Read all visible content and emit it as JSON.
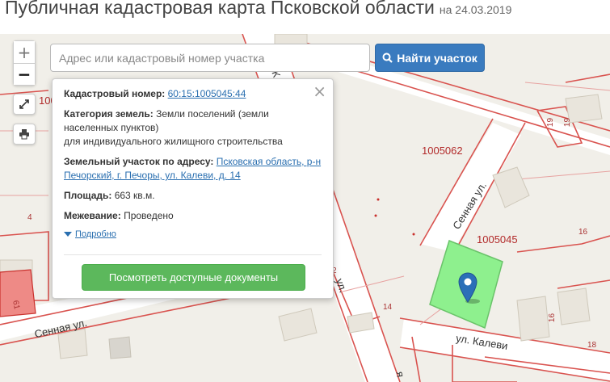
{
  "page": {
    "title": "Публичная кадастровая карта Псковской области",
    "date": "на 24.03.2019"
  },
  "search": {
    "placeholder": "Адрес или кадастровый номер участка",
    "value": "",
    "button_label": "Найти участок"
  },
  "zoom": {
    "plus": "+",
    "minus": "−"
  },
  "popup": {
    "cadastral_label": "Кадастровый номер:",
    "cadastral_value": "60:15:1005045:44",
    "category_label": "Категория земель:",
    "category_value_1": "Земли поселений (земли",
    "category_value_2": "населенных пунктов)",
    "category_value_3": "для индивидуального жилищного строительства",
    "address_label": "Земельный участок по адресу:",
    "address_value_1": "Псковская область, р-н",
    "address_value_2": "Печорский, г. Печоры, ул. Калеви, д. 14",
    "area_label": "Площадь:",
    "area_value": "663 кв.м.",
    "survey_label": "Межевание:",
    "survey_value": "Проведено",
    "more_label": "Подробно",
    "docs_button": "Посмотреть доступные документы",
    "close": "×"
  },
  "map": {
    "parcels": [
      "1005062",
      "1005045",
      "100"
    ],
    "plots": [
      "19",
      "19",
      "16",
      "16",
      "18",
      "4",
      "61",
      "2",
      "14"
    ],
    "streets": [
      "Сенная ул.",
      "Сенная ул.",
      "ул. Калеви",
      "ул.",
      "я",
      "К"
    ]
  },
  "colors": {
    "selected_parcel": "#8ef08e",
    "boundary": "#d9534f",
    "search_button": "#3a7bbf",
    "docs_button": "#5cb85c"
  },
  "icons": {
    "search": "search-icon",
    "fullscreen": "fullscreen-icon",
    "print": "print-icon",
    "marker": "map-marker-icon"
  }
}
